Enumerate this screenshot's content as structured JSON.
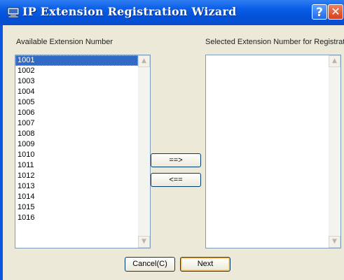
{
  "window": {
    "title": "IP Extension Registration Wizard",
    "help_label": "?",
    "close_label": "✕"
  },
  "available": {
    "label": "Available Extension Number",
    "items": [
      "1001",
      "1002",
      "1003",
      "1004",
      "1005",
      "1006",
      "1007",
      "1008",
      "1009",
      "1010",
      "1011",
      "1012",
      "1013",
      "1014",
      "1015",
      "1016"
    ],
    "selected_index": 0
  },
  "selected": {
    "label": "Selected Extension Number for Registration",
    "items": []
  },
  "buttons": {
    "add": "==>",
    "remove": "<==",
    "cancel": "Cancel(C)",
    "next": "Next"
  },
  "colors": {
    "titlebar": "#0a58e0",
    "selection": "#316ac5",
    "dialog_bg": "#ece9d8"
  }
}
